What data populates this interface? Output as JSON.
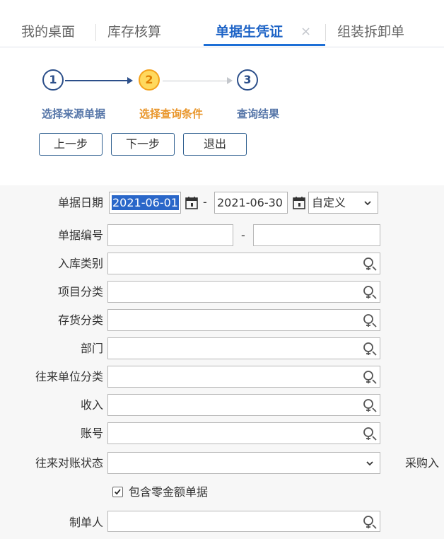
{
  "tabs": [
    {
      "label": "我的桌面"
    },
    {
      "label": "库存核算"
    },
    {
      "label": "单据生凭证"
    },
    {
      "label": "组装拆卸单"
    }
  ],
  "tab_close": "×",
  "steps": [
    {
      "number": "1",
      "label": "选择来源单据"
    },
    {
      "number": "2",
      "label": "选择查询条件"
    },
    {
      "number": "3",
      "label": "查询结果"
    }
  ],
  "buttons": {
    "prev": "上一步",
    "next": "下一步",
    "exit": "退出"
  },
  "form": {
    "date": {
      "label": "单据日期",
      "start": "2021-06-01",
      "separator": "-",
      "end": "2021-06-30",
      "range_option": "自定义"
    },
    "doc_no": {
      "label": "单据编号",
      "separator": "-",
      "from": "",
      "to": ""
    },
    "in_type": {
      "label": "入库类别",
      "value": ""
    },
    "project_category": {
      "label": "项目分类",
      "value": ""
    },
    "inventory_category": {
      "label": "存货分类",
      "value": ""
    },
    "department": {
      "label": "部门",
      "value": ""
    },
    "partner_category": {
      "label": "往来单位分类",
      "value": ""
    },
    "income": {
      "label": "收入",
      "value": ""
    },
    "account_no": {
      "label": "账号",
      "value": ""
    },
    "reconcile_status": {
      "label": "往来对账状态",
      "value": ""
    },
    "right_cut_label": "采购入",
    "include_zero": {
      "label": "包含零金额单据",
      "checked": true
    },
    "creator": {
      "label": "制单人",
      "value": ""
    }
  },
  "colors": {
    "accent": "#1d63c6",
    "step_current": "#f4a21c",
    "step_done": "#2c4f8a"
  }
}
